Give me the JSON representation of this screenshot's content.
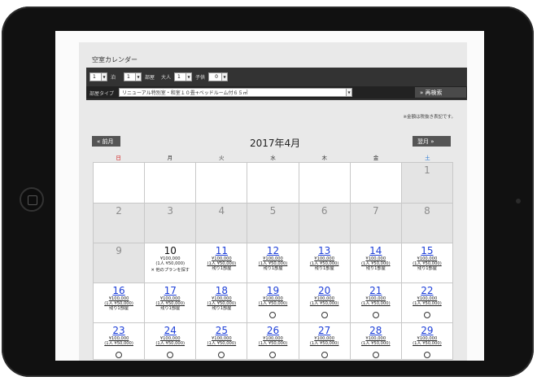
{
  "title": "空室カレンダー",
  "search": {
    "nights_value": "1",
    "nights_label": "泊",
    "rooms_value": "1",
    "rooms_label": "部屋",
    "adults_label": "大人",
    "adults_value": "1",
    "children_label": "子供",
    "children_value": "0",
    "room_type_label": "部屋タイプ",
    "room_type_value": "リニューアル特別室・和室１０畳+ベッドルーム付６５㎡",
    "research_button": "» 再検索"
  },
  "note": "※金額は税抜き表記です。",
  "nav": {
    "prev": "« 前月",
    "next": "翌月 »",
    "month": "2017年4月"
  },
  "weekdays": [
    "日",
    "月",
    "火",
    "水",
    "木",
    "金",
    "土"
  ],
  "days": {
    "d1": "1",
    "d2": "2",
    "d3": "3",
    "d4": "4",
    "d5": "5",
    "d6": "6",
    "d7": "7",
    "d8": "8",
    "d9": "9",
    "d10": "10",
    "d11": "11",
    "d12": "12",
    "d13": "13",
    "d14": "14",
    "d15": "15",
    "d16": "16",
    "d17": "17",
    "d18": "18",
    "d19": "19",
    "d20": "20",
    "d21": "21",
    "d22": "22",
    "d23": "23",
    "d24": "24",
    "d25": "25",
    "d26": "26",
    "d27": "27",
    "d28": "28",
    "d29": "29"
  },
  "cell": {
    "price": "¥100,000",
    "per_person": "(1人 ¥50,000)",
    "remaining": "残り1部屋",
    "other_plans": "✕ 他のプランを探す"
  }
}
